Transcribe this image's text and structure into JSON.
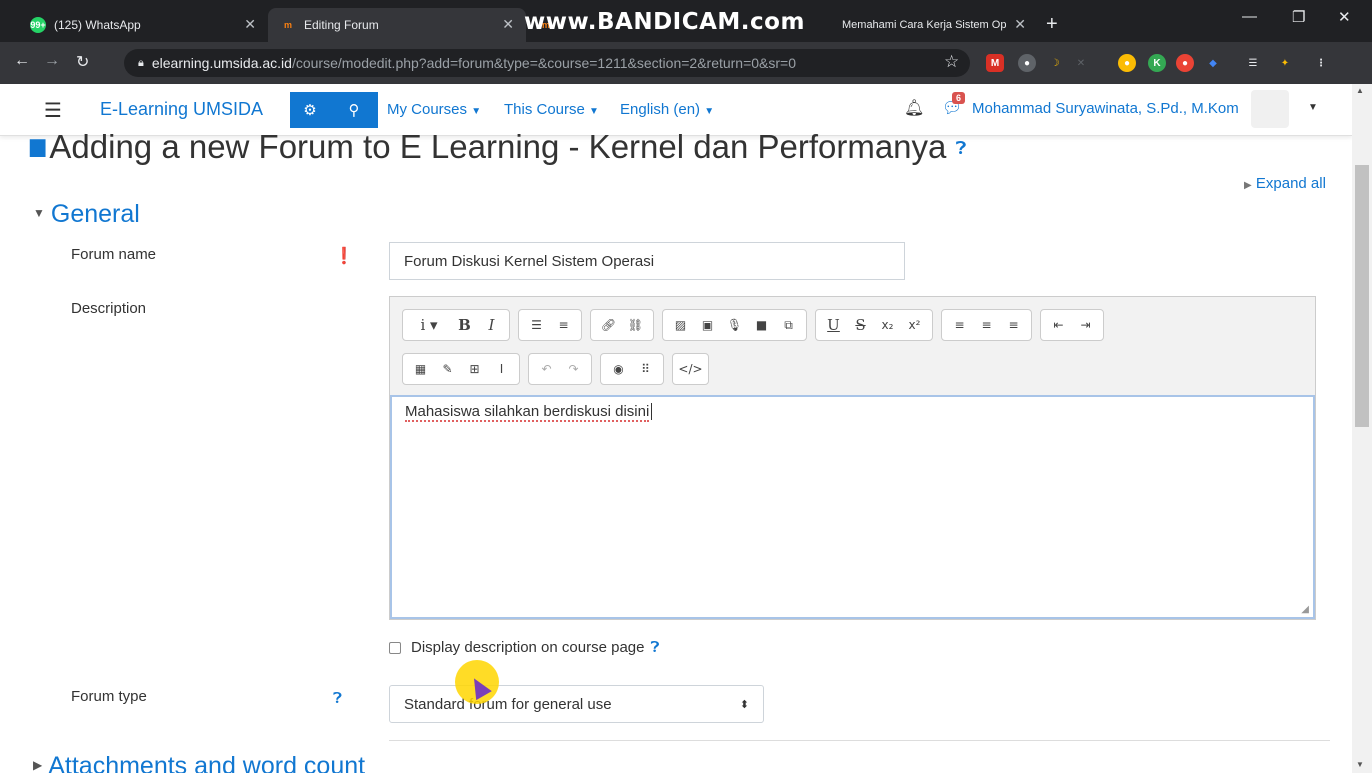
{
  "browser": {
    "tabs": [
      {
        "title": "(125) WhatsApp",
        "favicon": "whatsapp-icon",
        "color": "#25d366",
        "fav_text": "99+"
      },
      {
        "title": "Editing Forum",
        "favicon": "moodle-icon",
        "color": "#f98012",
        "fav_text": "m"
      },
      {
        "title": "Memahami Cara Kerja Sistem Op",
        "favicon": "moodle-icon",
        "color": "#f98012",
        "fav_text": "m"
      }
    ],
    "watermark": "www.BANDICAM.com",
    "url_host": "elearning.umsida.ac.id",
    "url_path": "/course/modedit.php?add=forum&type=&course=1211&section=2&return=0&sr=0"
  },
  "header": {
    "brand": "E-Learning UMSIDA",
    "menu": [
      "My Courses",
      "This Course",
      "English (en)"
    ],
    "notification_count": "6",
    "user_name": "Mohammad Suryawinata, S.Pd., M.Kom"
  },
  "page": {
    "title": "Adding a new Forum to E Learning - Kernel dan Performanya",
    "expand_all": "Expand all",
    "section_general": "General",
    "section_attachments": "Attachments and word count"
  },
  "form": {
    "forum_name_label": "Forum name",
    "forum_name_value": "Forum Diskusi Kernel Sistem Operasi",
    "description_label": "Description",
    "description_value": "Mahasiswa silahkan berdiskusi disini",
    "display_description_label": "Display description on course page",
    "display_description_checked": false,
    "forum_type_label": "Forum type",
    "forum_type_value": "Standard forum for general use"
  },
  "colors": {
    "accent": "#1177d1",
    "required": "#c9302c"
  }
}
